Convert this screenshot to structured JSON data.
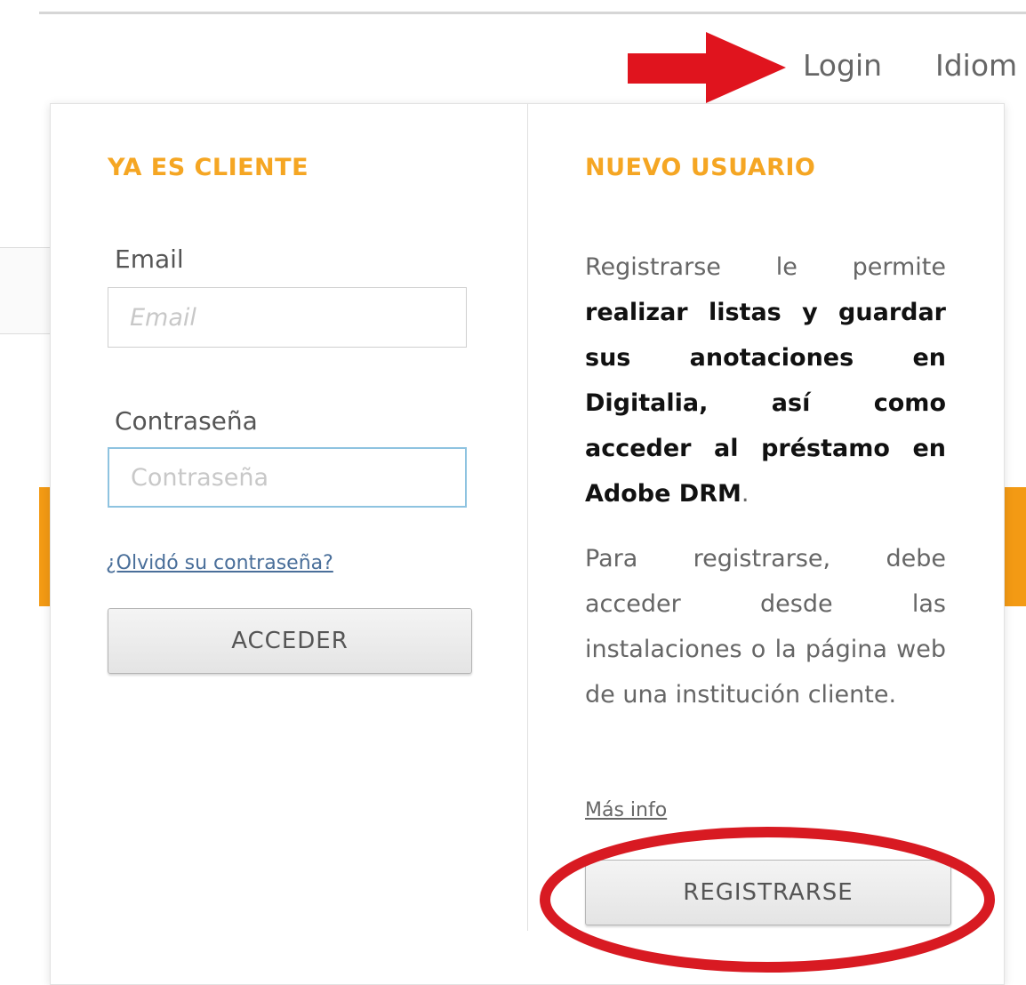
{
  "nav": {
    "login_label": "Login",
    "language_label": "Idiom"
  },
  "existing_client": {
    "title": "YA ES CLIENTE",
    "email_label": "Email",
    "email_placeholder": "Email",
    "password_label": "Contraseña",
    "password_placeholder": "Contraseña",
    "forgot_link": "¿Olvidó su contraseña?",
    "login_button": "ACCEDER"
  },
  "new_user": {
    "title": "NUEVO USUARIO",
    "intro_prefix": "Registrarse le permite ",
    "intro_bold": "realizar listas y guardar sus anotaciones en Digitalia, así como acceder al préstamo en Adobe DRM",
    "intro_suffix": ".",
    "register_info": "Para registrarse, debe acceder desde las instalaciones o la página web de una institución cliente.",
    "more_info_link": "Más info",
    "register_button": "REGISTRARSE"
  },
  "annotations": {
    "arrow_color": "#e0141e",
    "circle_color": "#d81a22"
  },
  "colors": {
    "section_title": "#f5a623",
    "accent_bar": "#f39a14"
  }
}
